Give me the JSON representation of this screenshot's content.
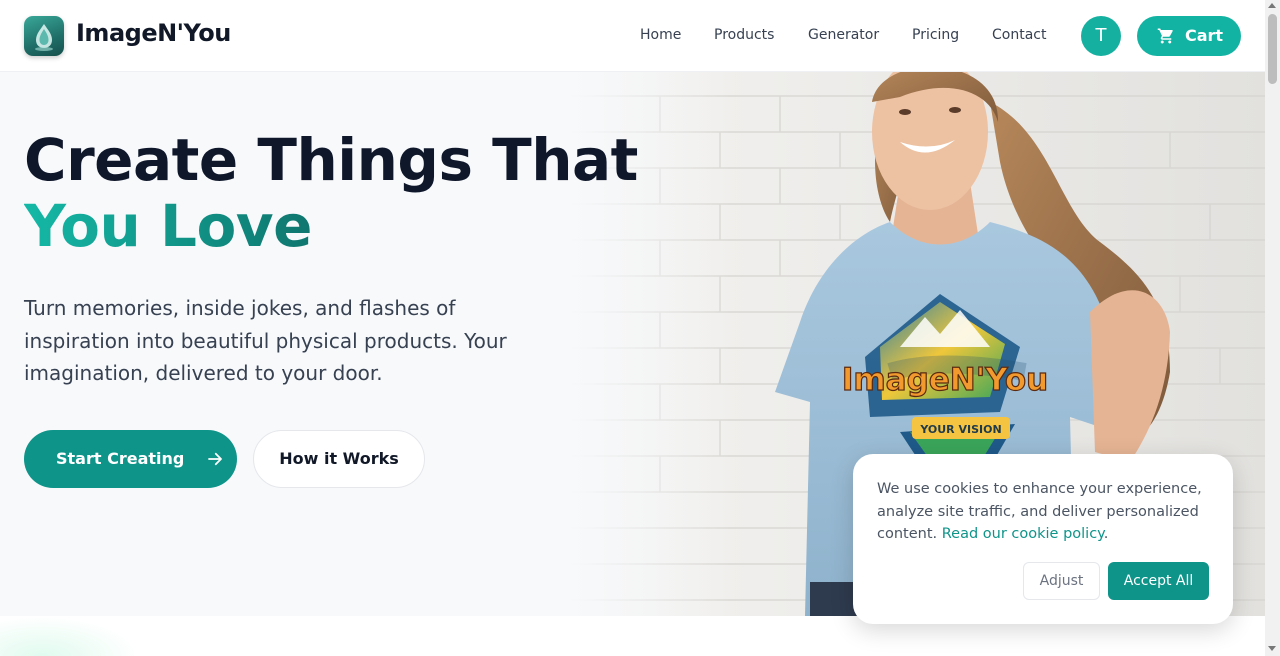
{
  "header": {
    "brand": "ImageN'You",
    "nav": [
      "Home",
      "Products",
      "Generator",
      "Pricing",
      "Contact"
    ],
    "avatar_initial": "T",
    "cart_label": "Cart"
  },
  "hero": {
    "title_line1": "Create Things That",
    "title_line2": "You Love",
    "lead": "Turn memories, inside jokes, and flashes of inspiration into beautiful physical products. Your imagination, delivered to your door.",
    "primary_cta": "Start Creating",
    "secondary_cta": "How it Works",
    "shirt_print_title": "ImageN'You",
    "shirt_print_subtitle": "YOUR VISION"
  },
  "cookie": {
    "text": "We use cookies to enhance your experience, analyze site traffic, and deliver personalized content.",
    "link": "Read our cookie policy",
    "adjust": "Adjust",
    "accept": "Accept All"
  },
  "colors": {
    "accent": "#0f948a",
    "accent_light": "#13b3a3",
    "heading": "#0f172a",
    "body_text": "#374151"
  },
  "icons": {
    "logo": "water-drop-icon",
    "cart": "cart-icon",
    "arrow": "arrow-right-icon"
  }
}
